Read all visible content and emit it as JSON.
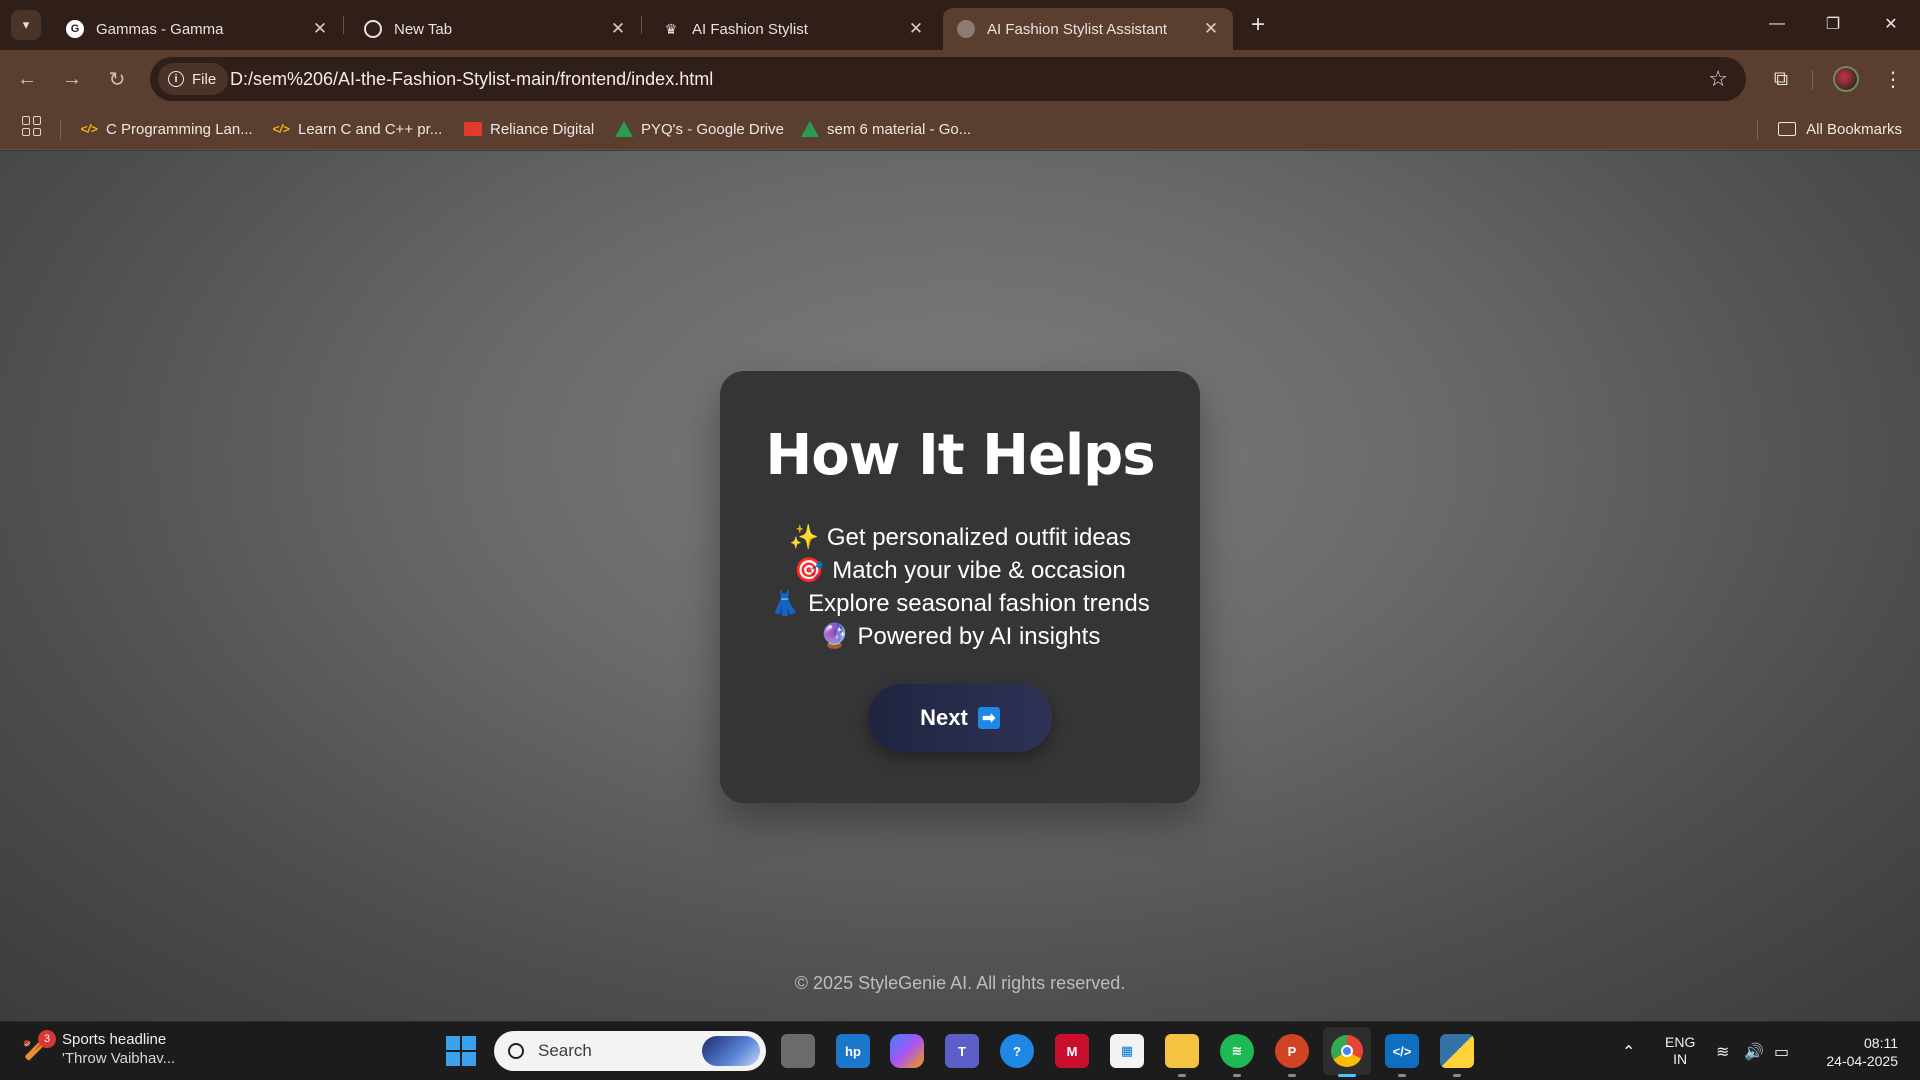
{
  "browser": {
    "tabs": [
      {
        "title": "Gammas - Gamma",
        "icon": "gamma-favicon-icon",
        "active": false
      },
      {
        "title": "New Tab",
        "icon": "chrome-favicon-icon",
        "active": false
      },
      {
        "title": "AI Fashion Stylist",
        "icon": "crown-favicon-icon",
        "active": false
      },
      {
        "title": "AI Fashion Stylist Assistant",
        "icon": "globe-favicon-icon",
        "active": true
      }
    ],
    "address": {
      "scheme_label": "File",
      "url": "D:/sem%206/AI-the-Fashion-Stylist-main/frontend/index.html"
    },
    "bookmarks": [
      {
        "label": "C Programming Lan...",
        "icon": "codewithharry-icon"
      },
      {
        "label": "Learn C and C++ pr...",
        "icon": "codewithharry-icon"
      },
      {
        "label": "Reliance Digital",
        "icon": "reliance-digital-icon"
      },
      {
        "label": "PYQ's - Google Drive",
        "icon": "google-drive-icon"
      },
      {
        "label": "sem 6 material - Go...",
        "icon": "google-drive-icon"
      }
    ],
    "all_bookmarks_label": "All Bookmarks"
  },
  "page": {
    "heading": "How It Helps",
    "features": [
      {
        "emoji": "✨",
        "text": "Get personalized outfit ideas"
      },
      {
        "emoji": "🎯",
        "text": "Match your vibe & occasion"
      },
      {
        "emoji": "👗",
        "text": "Explore seasonal fashion trends"
      },
      {
        "emoji": "🔮",
        "text": "Powered by AI insights"
      }
    ],
    "next_button": {
      "label": "Next",
      "arrow": "➡"
    },
    "footer": "© 2025 StyleGenie AI. All rights reserved."
  },
  "taskbar": {
    "news": {
      "badge": "3",
      "title": "Sports headline",
      "subtitle": "'Throw Vaibhav..."
    },
    "search_placeholder": "Search",
    "language": {
      "line1": "ENG",
      "line2": "IN"
    },
    "clock": {
      "time": "08:11",
      "date": "24-04-2025"
    },
    "colors": {
      "accent": "#4cc2ff",
      "start": "#3aa0f0"
    }
  }
}
